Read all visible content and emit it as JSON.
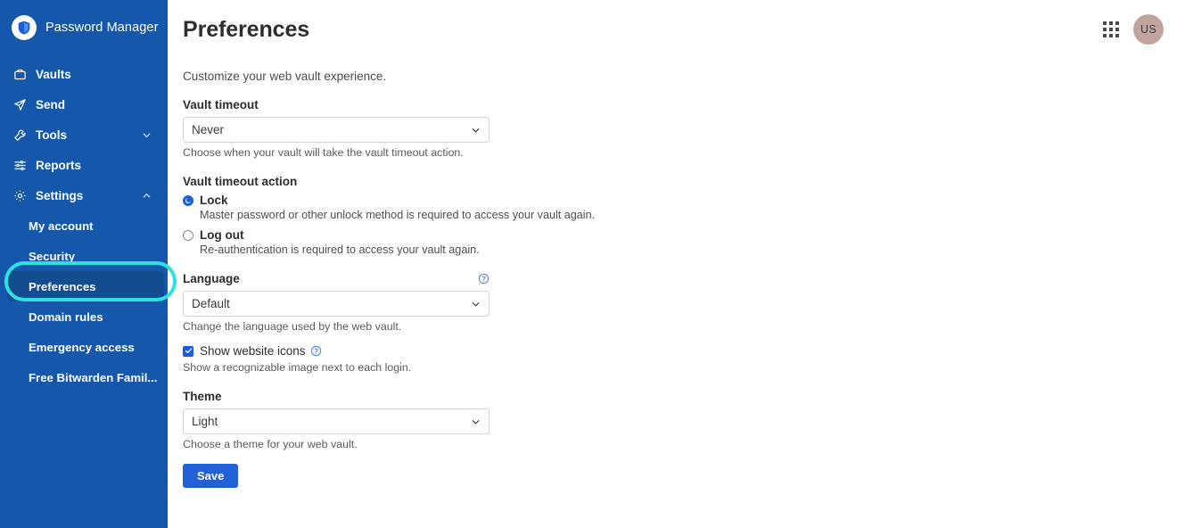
{
  "sidebar": {
    "brand": {
      "name": "Password Manager",
      "logo_icon": "bitwarden-shield-icon"
    },
    "nav": [
      {
        "label": "Vaults",
        "icon": "vault-icon",
        "expandable": false
      },
      {
        "label": "Send",
        "icon": "send-paper-plane-icon",
        "expandable": false
      },
      {
        "label": "Tools",
        "icon": "wrench-icon",
        "expandable": true,
        "chevron": "chevron-down-icon"
      },
      {
        "label": "Reports",
        "icon": "sliders-icon",
        "expandable": false
      },
      {
        "label": "Settings",
        "icon": "gear-icon",
        "expandable": true,
        "chevron": "chevron-up-icon"
      }
    ],
    "settings_sub": [
      {
        "label": "My account",
        "active": false
      },
      {
        "label": "Security",
        "active": false
      },
      {
        "label": "Preferences",
        "active": true
      },
      {
        "label": "Domain rules",
        "active": false
      },
      {
        "label": "Emergency access",
        "active": false
      },
      {
        "label": "Free Bitwarden Famil...",
        "active": false
      }
    ],
    "colors": {
      "background": "#1557ab",
      "active_item": "#134c8f",
      "highlight_ring": "#2ee1e1"
    }
  },
  "header": {
    "title": "Preferences",
    "grid_icon": "apps-grid-icon",
    "avatar": {
      "initials": "US",
      "color": "#c2a49e"
    }
  },
  "main": {
    "intro": "Customize your web vault experience.",
    "vault_timeout": {
      "label": "Vault timeout",
      "value": "Never",
      "helper": "Choose when your vault will take the vault timeout action.",
      "chevron": "chevron-down-icon"
    },
    "vault_timeout_action": {
      "label": "Vault timeout action",
      "options": [
        {
          "label": "Lock",
          "selected": true,
          "description": "Master password or other unlock method is required to access your vault again."
        },
        {
          "label": "Log out",
          "selected": false,
          "description": "Re-authentication is required to access your vault again."
        }
      ]
    },
    "language": {
      "label": "Language",
      "value": "Default",
      "helper": "Change the language used by the web vault.",
      "help_icon": "help-circle-icon",
      "chevron": "chevron-down-icon"
    },
    "show_website_icons": {
      "label": "Show website icons",
      "checked": true,
      "helper": "Show a recognizable image next to each login.",
      "help_icon": "help-circle-icon",
      "check_icon": "checkmark-icon"
    },
    "theme": {
      "label": "Theme",
      "value": "Light",
      "helper": "Choose a theme for your web vault.",
      "chevron": "chevron-down-icon"
    },
    "save_label": "Save"
  }
}
